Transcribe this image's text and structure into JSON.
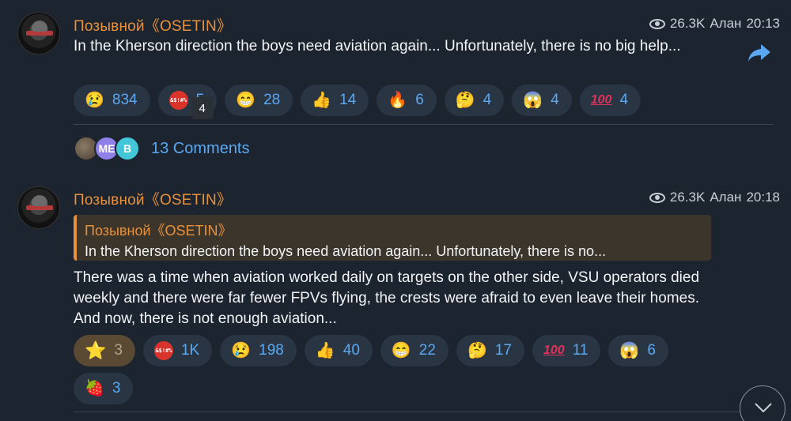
{
  "post1": {
    "author": "Позывной《OSETIN》",
    "views": "26.3K",
    "signature": "Алан",
    "time": "20:13",
    "text": "In the Kherson direction the boys need aviation again... Unfortunately, there is no big help...",
    "reactions": [
      {
        "emoji": "😢",
        "count": "834"
      },
      {
        "emoji": "swearing",
        "count": "5",
        "tooltip": "4"
      },
      {
        "emoji": "😁",
        "count": "28"
      },
      {
        "emoji": "👍",
        "count": "14"
      },
      {
        "emoji": "🔥",
        "count": "6"
      },
      {
        "emoji": "🤔",
        "count": "4"
      },
      {
        "emoji": "😱",
        "count": "4"
      },
      {
        "emoji": "💯",
        "count": "4"
      }
    ],
    "comments": {
      "avatars": [
        "",
        "ME",
        "B"
      ],
      "label": "13 Comments"
    }
  },
  "post2": {
    "author": "Позывной《OSETIN》",
    "views": "26.3K",
    "signature": "Алан",
    "time": "20:18",
    "quote": {
      "author": "Позывной《OSETIN》",
      "text": "In the Kherson direction the boys need aviation again... Unfortunately, there is no..."
    },
    "text": "There was a time when aviation worked daily on targets on the other side, VSU operators died weekly and there were far fewer FPVs flying, the crests were afraid to even leave their homes. And now, there is not enough aviation...",
    "reactions": [
      {
        "emoji": "⭐",
        "count": "3",
        "paid": true
      },
      {
        "emoji": "swearing",
        "count": "1K"
      },
      {
        "emoji": "😢",
        "count": "198"
      },
      {
        "emoji": "👍",
        "count": "40"
      },
      {
        "emoji": "😁",
        "count": "22"
      },
      {
        "emoji": "🤔",
        "count": "17"
      },
      {
        "emoji": "💯",
        "count": "11"
      },
      {
        "emoji": "😱",
        "count": "6"
      },
      {
        "emoji": "🍓",
        "count": "3"
      }
    ]
  },
  "colors": {
    "accent": "#5aa8f2",
    "author": "#e8913c",
    "background": "#1c242f",
    "chip": "#2a3543"
  }
}
